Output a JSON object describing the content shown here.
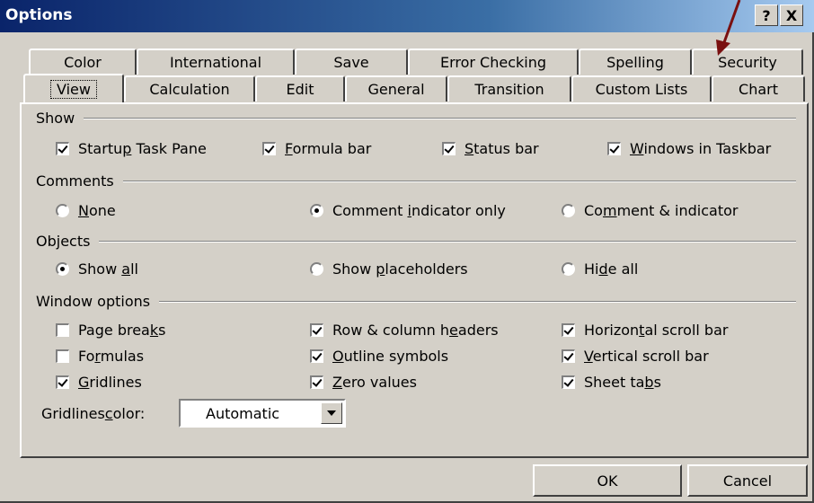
{
  "window": {
    "title": "Options",
    "help_label": "?",
    "close_label": "X"
  },
  "tabs_row1": [
    "Color",
    "International",
    "Save",
    "Error Checking",
    "Spelling",
    "Security"
  ],
  "tabs_row2": [
    "View",
    "Calculation",
    "Edit",
    "General",
    "Transition",
    "Custom Lists",
    "Chart"
  ],
  "active_tab": "View",
  "show": {
    "heading": "Show",
    "items": [
      {
        "pre": "Startu",
        "key": "p",
        "post": " Task Pane",
        "checked": true
      },
      {
        "pre": "",
        "key": "F",
        "post": "ormula bar",
        "checked": true
      },
      {
        "pre": "",
        "key": "S",
        "post": "tatus bar",
        "checked": true
      },
      {
        "pre": "",
        "key": "W",
        "post": "indows in Taskbar",
        "checked": true
      }
    ]
  },
  "comments": {
    "heading": "Comments",
    "items": [
      {
        "pre": "",
        "key": "N",
        "post": "one",
        "selected": false
      },
      {
        "pre": "Comment ",
        "key": "i",
        "post": "ndicator only",
        "selected": true
      },
      {
        "pre": "Co",
        "key": "m",
        "post": "ment & indicator",
        "selected": false
      }
    ]
  },
  "objects": {
    "heading": "Objects",
    "items": [
      {
        "pre": "Show ",
        "key": "a",
        "post": "ll",
        "selected": true
      },
      {
        "pre": "Show ",
        "key": "p",
        "post": "laceholders",
        "selected": false
      },
      {
        "pre": "Hi",
        "key": "d",
        "post": "e all",
        "selected": false
      }
    ]
  },
  "window_options": {
    "heading": "Window options",
    "items": [
      {
        "pre": "Page brea",
        "key": "k",
        "post": "s",
        "checked": false
      },
      {
        "pre": "Fo",
        "key": "r",
        "post": "mulas",
        "checked": false
      },
      {
        "pre": "",
        "key": "G",
        "post": "ridlines",
        "checked": true
      },
      {
        "pre": "Row & column h",
        "key": "e",
        "post": "aders",
        "checked": true
      },
      {
        "pre": "",
        "key": "O",
        "post": "utline symbols",
        "checked": true
      },
      {
        "pre": "",
        "key": "Z",
        "post": "ero values",
        "checked": true
      },
      {
        "pre": "Horizon",
        "key": "t",
        "post": "al scroll bar",
        "checked": true
      },
      {
        "pre": "",
        "key": "V",
        "post": "ertical scroll bar",
        "checked": true
      },
      {
        "pre": "Sheet ta",
        "key": "b",
        "post": "s",
        "checked": true
      }
    ]
  },
  "gridlines_color": {
    "pre": "Gridlines ",
    "key": "c",
    "post": "olor:",
    "value": "Automatic"
  },
  "buttons": {
    "ok": "OK",
    "cancel": "Cancel"
  },
  "annotation_arrow_color": "#7a1010"
}
